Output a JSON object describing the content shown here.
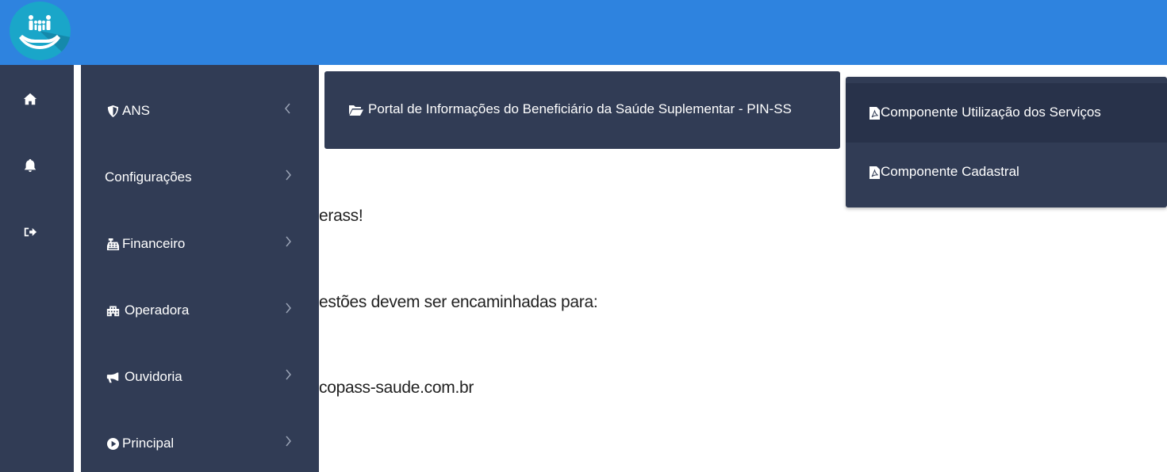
{
  "header": {
    "logo_icon": "family-care-logo-icon"
  },
  "rail": {
    "items": [
      {
        "icon": "home-icon"
      },
      {
        "icon": "bell-icon"
      },
      {
        "icon": "sign-out-icon"
      }
    ]
  },
  "menu": {
    "items": [
      {
        "label": "ANS",
        "icon": "shield-icon",
        "chevron": "chevron-left-icon"
      },
      {
        "label": "Configurações",
        "icon": "",
        "chevron": "chevron-right-icon"
      },
      {
        "label": "Financeiro",
        "icon": "cash-register-icon",
        "chevron": "chevron-right-icon"
      },
      {
        "label": "Operadora",
        "icon": "building-icon",
        "chevron": "chevron-right-icon"
      },
      {
        "label": "Ouvidoria",
        "icon": "bullhorn-icon",
        "chevron": "chevron-right-icon"
      },
      {
        "label": "Principal",
        "icon": "play-circle-icon",
        "chevron": "chevron-right-icon"
      }
    ]
  },
  "main": {
    "line1": "erass!",
    "line2": "estões devem ser encaminhadas para:",
    "line3": "copass-saude.com.br"
  },
  "portal": {
    "label": "Portal de Informações do Beneficiário da Saúde Suplementar - PIN-SS",
    "icon": "folder-open-icon"
  },
  "dropdown": {
    "items": [
      {
        "label": "Componente Utilização dos Serviços",
        "icon": "file-pdf-icon"
      },
      {
        "label": "Componente Cadastral",
        "icon": "file-pdf-icon"
      }
    ]
  },
  "colors": {
    "topbar": "#2e83df",
    "sidebar": "#313c55",
    "dropdown_active": "#28324a"
  }
}
